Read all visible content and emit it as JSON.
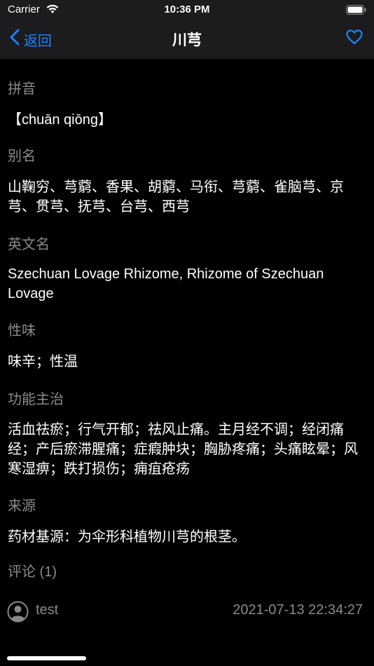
{
  "status_bar": {
    "carrier": "Carrier",
    "time": "10:36 PM"
  },
  "nav": {
    "back_label": "返回",
    "title": "川芎",
    "accent_color": "#1a84ff"
  },
  "sections": [
    {
      "title": "拼音",
      "body": "【chuān qiōng】"
    },
    {
      "title": "别名",
      "body": "山鞠穷、芎藭、香果、胡藭、马衔、芎藭、雀脑芎、京芎、贯芎、抚芎、台芎、西芎"
    },
    {
      "title": "英文名",
      "body": "Szechuan Lovage Rhizome, Rhizome of Szechuan Lovage"
    },
    {
      "title": "性味",
      "body": "味辛；性温"
    },
    {
      "title": "功能主治",
      "body": "活血祛瘀；行气开郁；祛风止痛。主月经不调；经闭痛经；产后瘀滞腥痛；症瘕肿块；胸胁疼痛；头痛眩晕；风寒湿痹；跌打损伤；痈疽疮疡"
    },
    {
      "title": "来源",
      "body": "药材基源：为伞形科植物川芎的根茎。"
    }
  ],
  "comments": {
    "header": "评论 (1)",
    "items": [
      {
        "user": "test",
        "date": "2021-07-13 22:34:27"
      }
    ]
  },
  "icons": {
    "back": "chevron-left-icon",
    "favorite": "heart-icon",
    "avatar": "user-avatar-icon",
    "wifi": "wifi-icon",
    "battery": "battery-icon"
  }
}
